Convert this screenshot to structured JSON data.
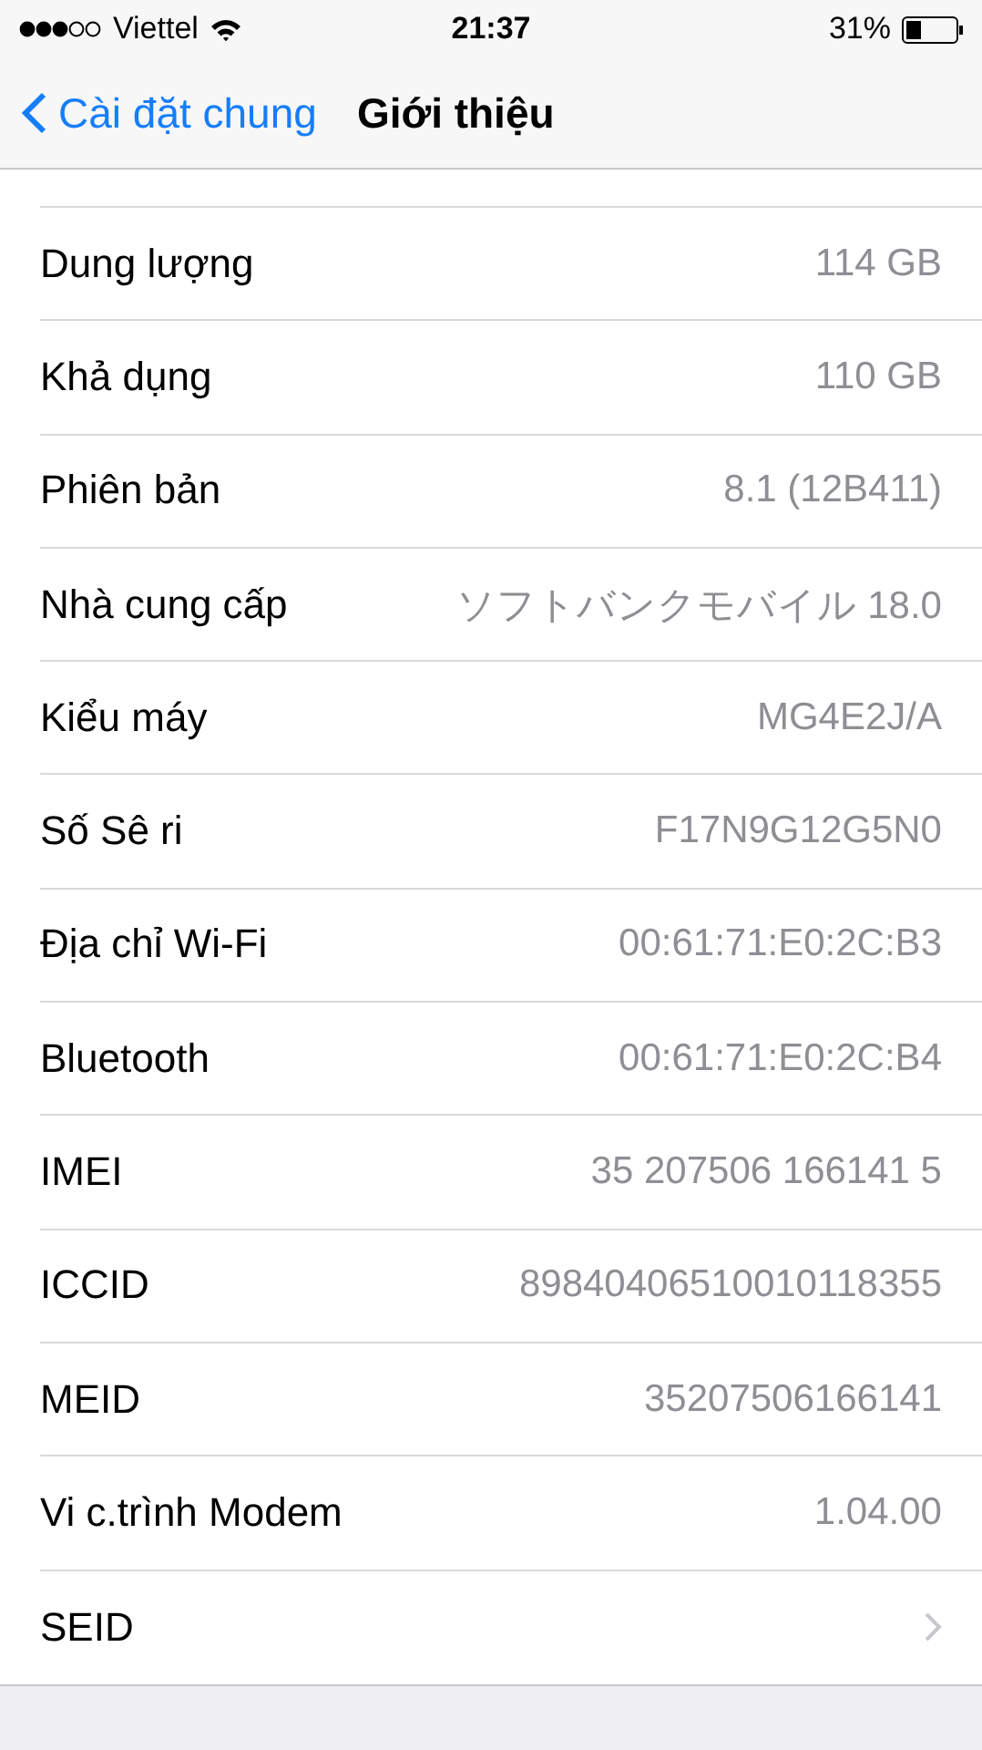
{
  "status_bar": {
    "carrier": "Viettel",
    "time": "21:37",
    "battery": "31%"
  },
  "nav": {
    "back": "Cài đặt chung",
    "title": "Giới thiệu"
  },
  "rows": [
    {
      "kind": "info",
      "label": "Dung lượng",
      "value": "114 GB"
    },
    {
      "kind": "info",
      "label": "Khả dụng",
      "value": "110 GB"
    },
    {
      "kind": "info",
      "label": "Phiên bản",
      "value": "8.1 (12B411)"
    },
    {
      "kind": "info",
      "label": "Nhà cung cấp",
      "value": "ソフトバンクモバイル 18.0"
    },
    {
      "kind": "info",
      "label": "Kiểu máy",
      "value": "MG4E2J/A"
    },
    {
      "kind": "info",
      "label": "Số Sê ri",
      "value": "F17N9G12G5N0"
    },
    {
      "kind": "info",
      "label": "Địa chỉ Wi-Fi",
      "value": "00:61:71:E0:2C:B3"
    },
    {
      "kind": "info",
      "label": "Bluetooth",
      "value": "00:61:71:E0:2C:B4"
    },
    {
      "kind": "info",
      "label": "IMEI",
      "value": "35 207506 166141 5"
    },
    {
      "kind": "info",
      "label": "ICCID",
      "value": "89840406510010118355"
    },
    {
      "kind": "info",
      "label": "MEID",
      "value": "35207506166141"
    },
    {
      "kind": "info",
      "label": "Vi c.trình Modem",
      "value": "1.04.00"
    },
    {
      "kind": "link",
      "label": "SEID"
    }
  ]
}
